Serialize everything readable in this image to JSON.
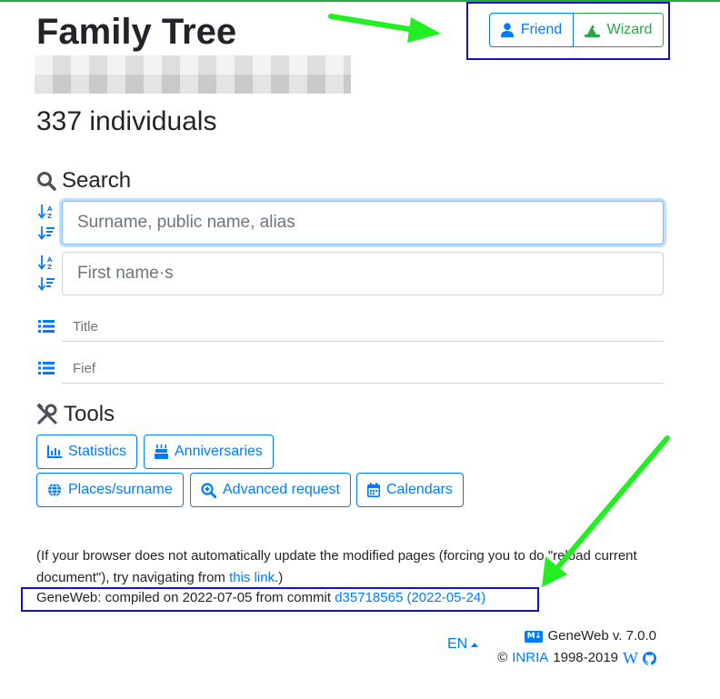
{
  "page": {
    "title": "Family Tree",
    "individuals": "337 individuals"
  },
  "modes": {
    "friend_label": "Friend",
    "wizard_label": "Wizard"
  },
  "search": {
    "title": "Search",
    "surname_placeholder": "Surname, public name, alias",
    "firstname_placeholder": "First name·s",
    "title_placeholder": "Title",
    "fief_placeholder": "Fief"
  },
  "tools": {
    "title": "Tools",
    "buttons": [
      "Statistics",
      "Anniversaries",
      "Places/surname",
      "Advanced request",
      "Calendars"
    ]
  },
  "notice": {
    "text_before": "(If your browser does not automatically update the modified pages (forcing you to do \"reload current document\"), try navigating from ",
    "link_text": "this link",
    "text_after": ".)"
  },
  "build": {
    "prefix": "GeneWeb: compiled on 2022-07-05 from commit ",
    "commit_link": "d35718565 (2022-05-24)"
  },
  "footer": {
    "language": "EN",
    "md_badge": "M↓",
    "version": "GeneWeb v. 7.0.0",
    "copyright": "©",
    "inria": "INRIA",
    "years": "1998-2019",
    "wiki": "W"
  },
  "colors": {
    "primary": "#007bff",
    "success": "#28a745",
    "annotation_box": "#1212cc",
    "annotation_arrow": "#22ee22"
  },
  "icons": [
    "user-icon",
    "wizard-hat-icon",
    "search-icon",
    "sort-alpha-icon",
    "sort-amount-icon",
    "list-icon",
    "tools-icon",
    "bar-chart-icon",
    "birthday-cake-icon",
    "globe-icon",
    "search-plus-icon",
    "calendar-icon",
    "caret-up-icon",
    "markdown-icon",
    "github-icon"
  ]
}
